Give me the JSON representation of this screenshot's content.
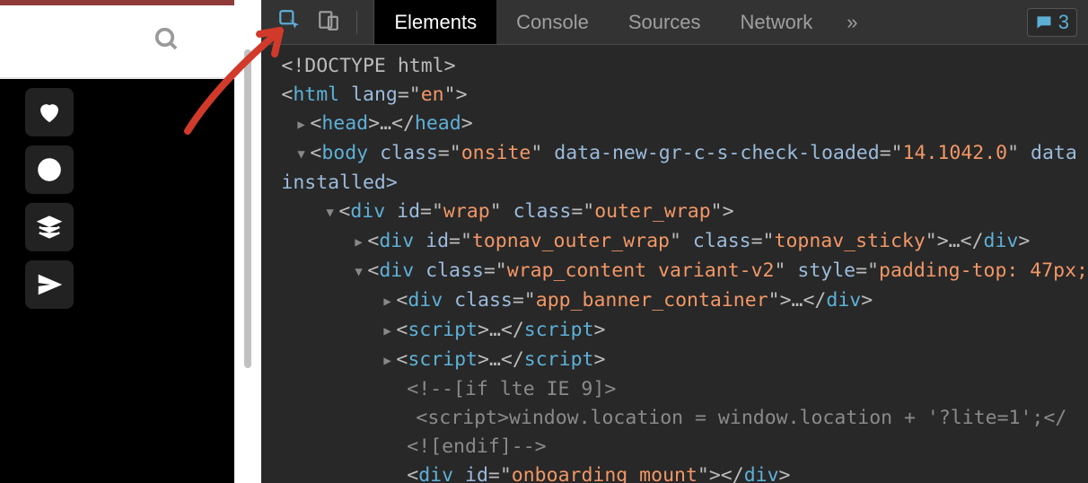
{
  "tabs": {
    "elements": "Elements",
    "console": "Console",
    "sources": "Sources",
    "network": "Network",
    "more": "»"
  },
  "messages_count": "3",
  "left_sidebar_icons": [
    "heart-icon",
    "clock-icon",
    "stack-icon",
    "paper-plane-icon"
  ],
  "dom": {
    "l1": {
      "text": "<!DOCTYPE html>"
    },
    "l2": {
      "tag": "html",
      "attr": "lang",
      "val": "en"
    },
    "l3": {
      "tag_open": "head",
      "tag_close": "head",
      "ellipsis": "…"
    },
    "l4": {
      "tag": "body",
      "a1": "class",
      "v1": "onsite",
      "a2": "data-new-gr-c-s-check-loaded",
      "v2": "14.1042.0",
      "a3": "data",
      "cont": "installed>"
    },
    "l5": {
      "tag": "div",
      "a1": "id",
      "v1": "wrap",
      "a2": "class",
      "v2": "outer_wrap"
    },
    "l6": {
      "tag": "div",
      "a1": "id",
      "v1": "topnav_outer_wrap",
      "a2": "class",
      "v2": "topnav_sticky",
      "ellipsis": "…",
      "close": "div"
    },
    "l7": {
      "tag": "div",
      "a1": "class",
      "v1": "wrap_content variant-v2",
      "a2": "style",
      "v2": "padding-top: 47px;"
    },
    "l8": {
      "tag": "div",
      "a1": "class",
      "v1": "app_banner_container",
      "ellipsis": "…",
      "close": "div"
    },
    "l9": {
      "tag": "script",
      "ellipsis": "…",
      "close": "script"
    },
    "l10": {
      "tag": "script",
      "ellipsis": "…",
      "close": "script"
    },
    "l11": {
      "comment": "<!--[if lte IE 9]>"
    },
    "l12": {
      "open": "<script>",
      "body": "window.location = window.location + '?lite=1';",
      "close": "</"
    },
    "l13": {
      "comment": "<![endif]-->"
    },
    "l14": {
      "tag": "div",
      "a1": "id",
      "v1": "onboarding_mount",
      "close": "div"
    }
  }
}
